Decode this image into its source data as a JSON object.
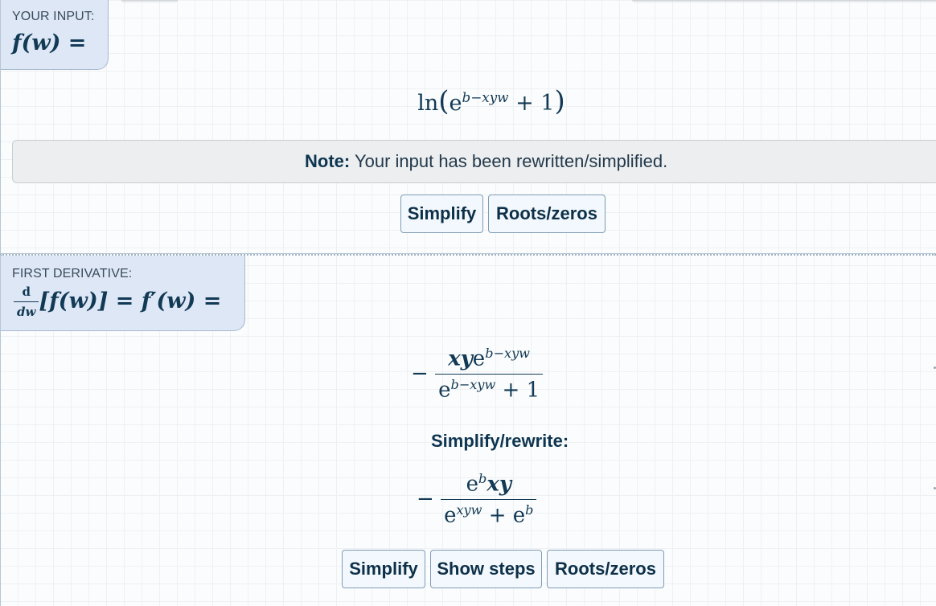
{
  "input": {
    "caption": "YOUR INPUT:",
    "function_label": "f(w) =",
    "expression": {
      "ln": "ln",
      "base": "e",
      "exponent": "b−xyw",
      "plus_one": "+ 1"
    },
    "note_strong": "Note:",
    "note_text": "Your input has been rewritten/simplified.",
    "buttons": {
      "simplify": "Simplify",
      "roots": "Roots/zeros"
    }
  },
  "derivative": {
    "caption": "FIRST DERIVATIVE:",
    "d_num": "d",
    "d_den": "dw",
    "lhs_rest": "[f(w)] = f′(w) =",
    "result": {
      "minus": "−",
      "num_vars": "xy",
      "num_base": "e",
      "num_exp": "b−xyw",
      "den_base": "e",
      "den_exp": "b−xyw",
      "den_plus": "+ 1"
    },
    "simplify_heading": "Simplify/rewrite:",
    "simplified": {
      "minus": "−",
      "num_base": "e",
      "num_exp": "b",
      "num_vars": "xy",
      "den_base1": "e",
      "den_exp1": "xyw",
      "den_plus": "+",
      "den_base2": "e",
      "den_exp2": "b"
    },
    "buttons": {
      "simplify": "Simplify",
      "steps": "Show steps",
      "roots": "Roots/zeros"
    }
  }
}
